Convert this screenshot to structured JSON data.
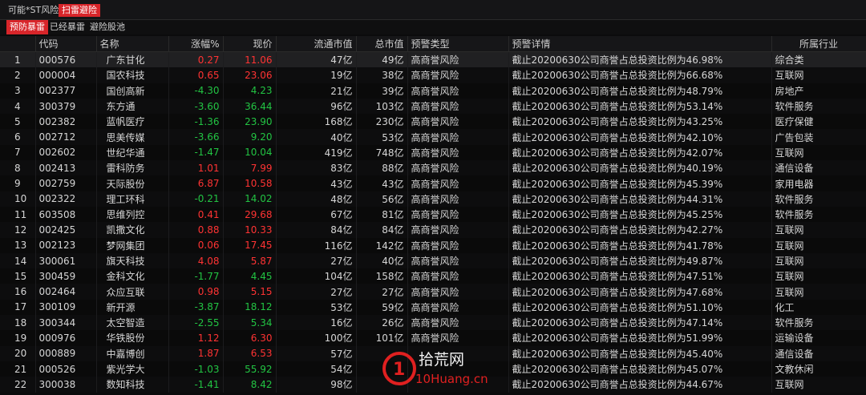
{
  "top_tabs": [
    {
      "label": "可能*ST风险",
      "active": false
    },
    {
      "label": "扫雷避险",
      "active": true
    }
  ],
  "sub_tabs": [
    {
      "label": "预防暴雷",
      "active": true
    },
    {
      "label": "已经暴雷",
      "active": false
    },
    {
      "label": "避险股池",
      "active": false
    }
  ],
  "columns": {
    "idx": "",
    "code": "代码",
    "name": "名称",
    "change": "涨幅%",
    "price": "现价",
    "float_cap": "流通市值",
    "total_cap": "总市值",
    "warn_type": "预警类型",
    "warn_detail": "预警详情",
    "industry": "所属行业"
  },
  "rows": [
    {
      "idx": "1",
      "code": "000576",
      "name": "广东甘化",
      "change": "0.27",
      "price": "11.06",
      "float_cap": "47亿",
      "total_cap": "49亿",
      "warn_type": "高商誉风险",
      "warn_detail": "截止20200630公司商誉占总投资比例为46.98%",
      "industry": "综合类",
      "dir": "up"
    },
    {
      "idx": "2",
      "code": "000004",
      "name": "国农科技",
      "change": "0.65",
      "price": "23.06",
      "float_cap": "19亿",
      "total_cap": "38亿",
      "warn_type": "高商誉风险",
      "warn_detail": "截止20200630公司商誉占总投资比例为66.68%",
      "industry": "互联网",
      "dir": "up"
    },
    {
      "idx": "3",
      "code": "002377",
      "name": "国创高新",
      "change": "-4.30",
      "price": "4.23",
      "float_cap": "21亿",
      "total_cap": "39亿",
      "warn_type": "高商誉风险",
      "warn_detail": "截止20200630公司商誉占总投资比例为48.79%",
      "industry": "房地产",
      "dir": "down"
    },
    {
      "idx": "4",
      "code": "300379",
      "name": "东方通",
      "change": "-3.60",
      "price": "36.44",
      "float_cap": "96亿",
      "total_cap": "103亿",
      "warn_type": "高商誉风险",
      "warn_detail": "截止20200630公司商誉占总投资比例为53.14%",
      "industry": "软件服务",
      "dir": "down"
    },
    {
      "idx": "5",
      "code": "002382",
      "name": "蓝帆医疗",
      "change": "-1.36",
      "price": "23.90",
      "float_cap": "168亿",
      "total_cap": "230亿",
      "warn_type": "高商誉风险",
      "warn_detail": "截止20200630公司商誉占总投资比例为43.25%",
      "industry": "医疗保健",
      "dir": "down"
    },
    {
      "idx": "6",
      "code": "002712",
      "name": "思美传媒",
      "change": "-3.66",
      "price": "9.20",
      "float_cap": "40亿",
      "total_cap": "53亿",
      "warn_type": "高商誉风险",
      "warn_detail": "截止20200630公司商誉占总投资比例为42.10%",
      "industry": "广告包装",
      "dir": "down"
    },
    {
      "idx": "7",
      "code": "002602",
      "name": "世纪华通",
      "change": "-1.47",
      "price": "10.04",
      "float_cap": "419亿",
      "total_cap": "748亿",
      "warn_type": "高商誉风险",
      "warn_detail": "截止20200630公司商誉占总投资比例为42.07%",
      "industry": "互联网",
      "dir": "down"
    },
    {
      "idx": "8",
      "code": "002413",
      "name": "雷科防务",
      "change": "1.01",
      "price": "7.99",
      "float_cap": "83亿",
      "total_cap": "88亿",
      "warn_type": "高商誉风险",
      "warn_detail": "截止20200630公司商誉占总投资比例为40.19%",
      "industry": "通信设备",
      "dir": "up"
    },
    {
      "idx": "9",
      "code": "002759",
      "name": "天际股份",
      "change": "6.87",
      "price": "10.58",
      "float_cap": "43亿",
      "total_cap": "43亿",
      "warn_type": "高商誉风险",
      "warn_detail": "截止20200630公司商誉占总投资比例为45.39%",
      "industry": "家用电器",
      "dir": "up"
    },
    {
      "idx": "10",
      "code": "002322",
      "name": "理工环科",
      "change": "-0.21",
      "price": "14.02",
      "float_cap": "48亿",
      "total_cap": "56亿",
      "warn_type": "高商誉风险",
      "warn_detail": "截止20200630公司商誉占总投资比例为44.31%",
      "industry": "软件服务",
      "dir": "down"
    },
    {
      "idx": "11",
      "code": "603508",
      "name": "思维列控",
      "change": "0.41",
      "price": "29.68",
      "float_cap": "67亿",
      "total_cap": "81亿",
      "warn_type": "高商誉风险",
      "warn_detail": "截止20200630公司商誉占总投资比例为45.25%",
      "industry": "软件服务",
      "dir": "up"
    },
    {
      "idx": "12",
      "code": "002425",
      "name": "凯撒文化",
      "change": "0.88",
      "price": "10.33",
      "float_cap": "84亿",
      "total_cap": "84亿",
      "warn_type": "高商誉风险",
      "warn_detail": "截止20200630公司商誉占总投资比例为42.27%",
      "industry": "互联网",
      "dir": "up"
    },
    {
      "idx": "13",
      "code": "002123",
      "name": "梦网集团",
      "change": "0.06",
      "price": "17.45",
      "float_cap": "116亿",
      "total_cap": "142亿",
      "warn_type": "高商誉风险",
      "warn_detail": "截止20200630公司商誉占总投资比例为41.78%",
      "industry": "互联网",
      "dir": "up"
    },
    {
      "idx": "14",
      "code": "300061",
      "name": "旗天科技",
      "change": "4.08",
      "price": "5.87",
      "float_cap": "27亿",
      "total_cap": "40亿",
      "warn_type": "高商誉风险",
      "warn_detail": "截止20200630公司商誉占总投资比例为49.87%",
      "industry": "互联网",
      "dir": "up"
    },
    {
      "idx": "15",
      "code": "300459",
      "name": "金科文化",
      "change": "-1.77",
      "price": "4.45",
      "float_cap": "104亿",
      "total_cap": "158亿",
      "warn_type": "高商誉风险",
      "warn_detail": "截止20200630公司商誉占总投资比例为47.51%",
      "industry": "互联网",
      "dir": "down"
    },
    {
      "idx": "16",
      "code": "002464",
      "name": "众应互联",
      "change": "0.98",
      "price": "5.15",
      "float_cap": "27亿",
      "total_cap": "27亿",
      "warn_type": "高商誉风险",
      "warn_detail": "截止20200630公司商誉占总投资比例为47.68%",
      "industry": "互联网",
      "dir": "up"
    },
    {
      "idx": "17",
      "code": "300109",
      "name": "新开源",
      "change": "-3.87",
      "price": "18.12",
      "float_cap": "53亿",
      "total_cap": "59亿",
      "warn_type": "高商誉风险",
      "warn_detail": "截止20200630公司商誉占总投资比例为51.10%",
      "industry": "化工",
      "dir": "down"
    },
    {
      "idx": "18",
      "code": "300344",
      "name": "太空智造",
      "change": "-2.55",
      "price": "5.34",
      "float_cap": "16亿",
      "total_cap": "26亿",
      "warn_type": "高商誉风险",
      "warn_detail": "截止20200630公司商誉占总投资比例为47.14%",
      "industry": "软件服务",
      "dir": "down"
    },
    {
      "idx": "19",
      "code": "000976",
      "name": "华铁股份",
      "change": "1.12",
      "price": "6.30",
      "float_cap": "100亿",
      "total_cap": "101亿",
      "warn_type": "高商誉风险",
      "warn_detail": "截止20200630公司商誉占总投资比例为51.99%",
      "industry": "运输设备",
      "dir": "up"
    },
    {
      "idx": "20",
      "code": "000889",
      "name": "中嘉博创",
      "change": "1.87",
      "price": "6.53",
      "float_cap": "57亿",
      "total_cap": "",
      "warn_type": "",
      "warn_detail": "截止20200630公司商誉占总投资比例为45.40%",
      "industry": "通信设备",
      "dir": "up"
    },
    {
      "idx": "21",
      "code": "000526",
      "name": "紫光学大",
      "change": "-1.03",
      "price": "55.92",
      "float_cap": "54亿",
      "total_cap": "",
      "warn_type": "",
      "warn_detail": "截止20200630公司商誉占总投资比例为45.07%",
      "industry": "文教休闲",
      "dir": "down"
    },
    {
      "idx": "22",
      "code": "300038",
      "name": "数知科技",
      "change": "-1.41",
      "price": "8.42",
      "float_cap": "98亿",
      "total_cap": "",
      "warn_type": "",
      "warn_detail": "截止20200630公司商誉占总投资比例为44.67%",
      "industry": "互联网",
      "dir": "down"
    }
  ],
  "watermark": {
    "main": "拾荒网",
    "sub": "10Huang.cn"
  },
  "colors": {
    "up": "#ff3333",
    "down": "#22c443",
    "active_tab": "#d8252a"
  }
}
